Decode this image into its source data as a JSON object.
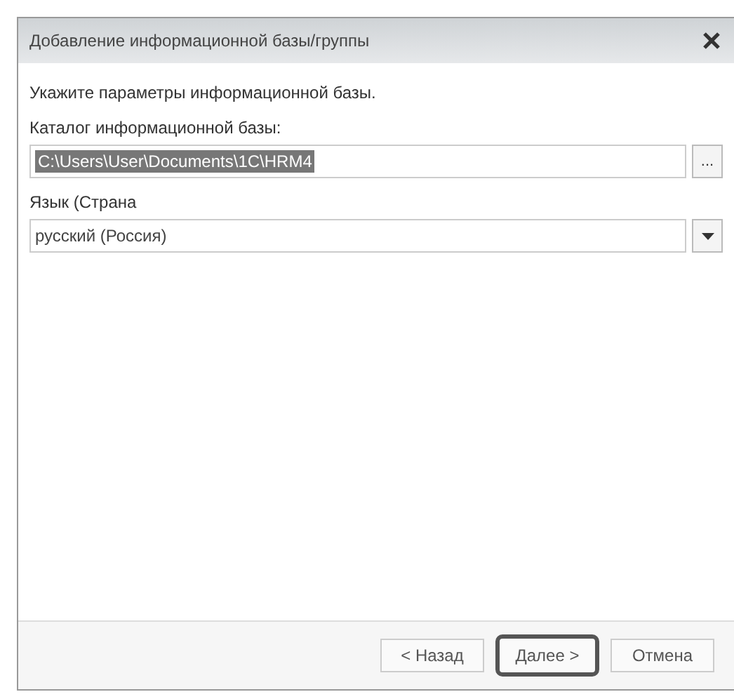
{
  "window": {
    "title": "Добавление информационной базы/группы"
  },
  "prompt": "Укажите параметры информационной базы.",
  "catalog": {
    "label": "Каталог информационной базы:",
    "value": "C:\\Users\\User\\Documents\\1C\\HRM4",
    "selected": true,
    "browse": "..."
  },
  "language": {
    "label": "Язык (Страна",
    "value": "русский (Россия)"
  },
  "buttons": [
    {
      "label": "< Назад",
      "focused": false
    },
    {
      "label": "Далее >",
      "focused": true
    },
    {
      "label": "Отмена",
      "focused": false
    }
  ]
}
